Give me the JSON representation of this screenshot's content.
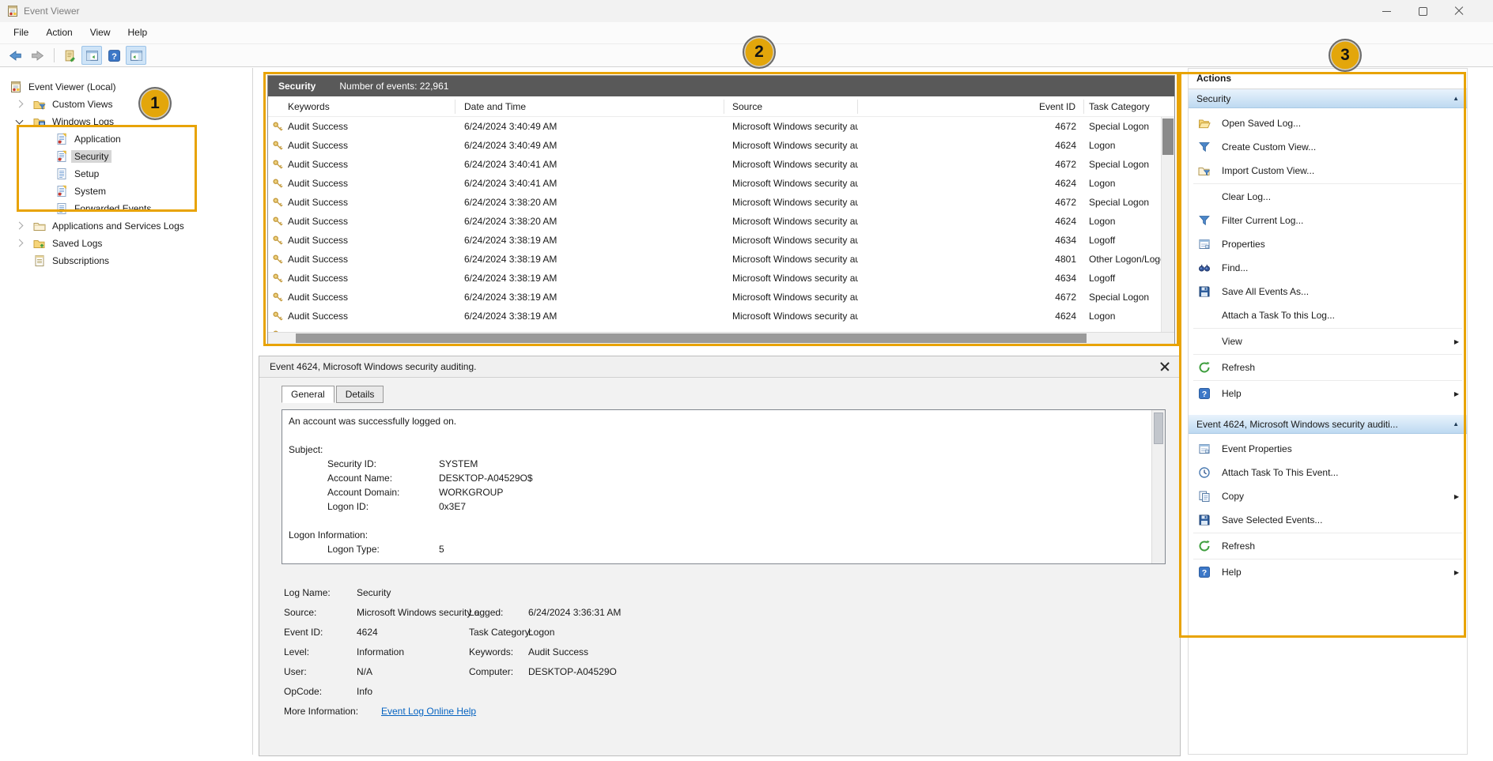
{
  "window": {
    "title": "Event Viewer"
  },
  "menu": {
    "items": [
      "File",
      "Action",
      "View",
      "Help"
    ]
  },
  "tree": {
    "items": [
      {
        "label": "Event Viewer (Local)"
      },
      {
        "label": "Custom Views"
      },
      {
        "label": "Windows Logs"
      },
      {
        "label": "Application"
      },
      {
        "label": "Security"
      },
      {
        "label": "Setup"
      },
      {
        "label": "System"
      },
      {
        "label": "Forwarded Events"
      },
      {
        "label": "Applications and Services Logs"
      },
      {
        "label": "Saved Logs"
      },
      {
        "label": "Subscriptions"
      }
    ]
  },
  "list": {
    "log_name": "Security",
    "count_label": "Number of events: 22,961",
    "columns": {
      "keywords": "Keywords",
      "datetime": "Date and Time",
      "source": "Source",
      "event_id": "Event ID",
      "task": "Task Category"
    },
    "rows": [
      {
        "keywords": "Audit Success",
        "datetime": "6/24/2024 3:40:49 AM",
        "source": "Microsoft Windows security au...",
        "event_id": "4672",
        "task": "Special Logon"
      },
      {
        "keywords": "Audit Success",
        "datetime": "6/24/2024 3:40:49 AM",
        "source": "Microsoft Windows security au...",
        "event_id": "4624",
        "task": "Logon"
      },
      {
        "keywords": "Audit Success",
        "datetime": "6/24/2024 3:40:41 AM",
        "source": "Microsoft Windows security au...",
        "event_id": "4672",
        "task": "Special Logon"
      },
      {
        "keywords": "Audit Success",
        "datetime": "6/24/2024 3:40:41 AM",
        "source": "Microsoft Windows security au...",
        "event_id": "4624",
        "task": "Logon"
      },
      {
        "keywords": "Audit Success",
        "datetime": "6/24/2024 3:38:20 AM",
        "source": "Microsoft Windows security au...",
        "event_id": "4672",
        "task": "Special Logon"
      },
      {
        "keywords": "Audit Success",
        "datetime": "6/24/2024 3:38:20 AM",
        "source": "Microsoft Windows security au...",
        "event_id": "4624",
        "task": "Logon"
      },
      {
        "keywords": "Audit Success",
        "datetime": "6/24/2024 3:38:19 AM",
        "source": "Microsoft Windows security au...",
        "event_id": "4634",
        "task": "Logoff"
      },
      {
        "keywords": "Audit Success",
        "datetime": "6/24/2024 3:38:19 AM",
        "source": "Microsoft Windows security au...",
        "event_id": "4801",
        "task": "Other Logon/Logoff"
      },
      {
        "keywords": "Audit Success",
        "datetime": "6/24/2024 3:38:19 AM",
        "source": "Microsoft Windows security au...",
        "event_id": "4634",
        "task": "Logoff"
      },
      {
        "keywords": "Audit Success",
        "datetime": "6/24/2024 3:38:19 AM",
        "source": "Microsoft Windows security au...",
        "event_id": "4672",
        "task": "Special Logon"
      },
      {
        "keywords": "Audit Success",
        "datetime": "6/24/2024 3:38:19 AM",
        "source": "Microsoft Windows security au...",
        "event_id": "4624",
        "task": "Logon"
      }
    ]
  },
  "details": {
    "title": "Event 4624, Microsoft Windows security auditing.",
    "tabs": {
      "general": "General",
      "details": "Details"
    },
    "description": [
      {
        "label": "An account was successfully logged on.",
        "value": ""
      },
      {
        "label": "",
        "value": ""
      },
      {
        "label": "Subject:",
        "value": ""
      },
      {
        "label": "Security ID:",
        "value": "SYSTEM"
      },
      {
        "label": "Account Name:",
        "value": "DESKTOP-A04529O$"
      },
      {
        "label": "Account Domain:",
        "value": "WORKGROUP"
      },
      {
        "label": "Logon ID:",
        "value": "0x3E7"
      },
      {
        "label": "",
        "value": ""
      },
      {
        "label": "Logon Information:",
        "value": ""
      },
      {
        "label": "Logon Type:",
        "value": "5"
      }
    ],
    "meta": {
      "log_name_label": "Log Name:",
      "log_name": "Security",
      "source_label": "Source:",
      "source": "Microsoft Windows security a",
      "logged_label": "Logged:",
      "logged": "6/24/2024 3:36:31 AM",
      "event_id_label": "Event ID:",
      "event_id": "4624",
      "task_label": "Task Category:",
      "task": "Logon",
      "level_label": "Level:",
      "level": "Information",
      "keywords_label": "Keywords:",
      "keywords": "Audit Success",
      "user_label": "User:",
      "user": "N/A",
      "computer_label": "Computer:",
      "computer": "DESKTOP-A04529O",
      "opcode_label": "OpCode:",
      "opcode": "Info",
      "more_info_label": "More Information:",
      "more_info_link": "Event Log Online Help"
    }
  },
  "actions": {
    "title": "Actions",
    "sections": [
      {
        "title": "Security",
        "items": [
          {
            "label": "Open Saved Log..."
          },
          {
            "label": "Create Custom View..."
          },
          {
            "label": "Import Custom View..."
          },
          {
            "label": "Clear Log..."
          },
          {
            "label": "Filter Current Log..."
          },
          {
            "label": "Properties"
          },
          {
            "label": "Find..."
          },
          {
            "label": "Save All Events As..."
          },
          {
            "label": "Attach a Task To this Log..."
          },
          {
            "label": "View"
          },
          {
            "label": "Refresh"
          },
          {
            "label": "Help"
          }
        ]
      },
      {
        "title": "Event 4624, Microsoft Windows security auditi...",
        "items": [
          {
            "label": "Event Properties"
          },
          {
            "label": "Attach Task To This Event..."
          },
          {
            "label": "Copy"
          },
          {
            "label": "Save Selected Events..."
          },
          {
            "label": "Refresh"
          },
          {
            "label": "Help"
          }
        ]
      }
    ]
  },
  "annotations": {
    "badges": [
      {
        "label": "1"
      },
      {
        "label": "2"
      },
      {
        "label": "3"
      }
    ],
    "color": "#E8A303"
  },
  "colors": {
    "annotation": "#E8A303",
    "list_header_bar": "#595959",
    "link": "#0563C1",
    "section_header": "#BDD9F1"
  }
}
